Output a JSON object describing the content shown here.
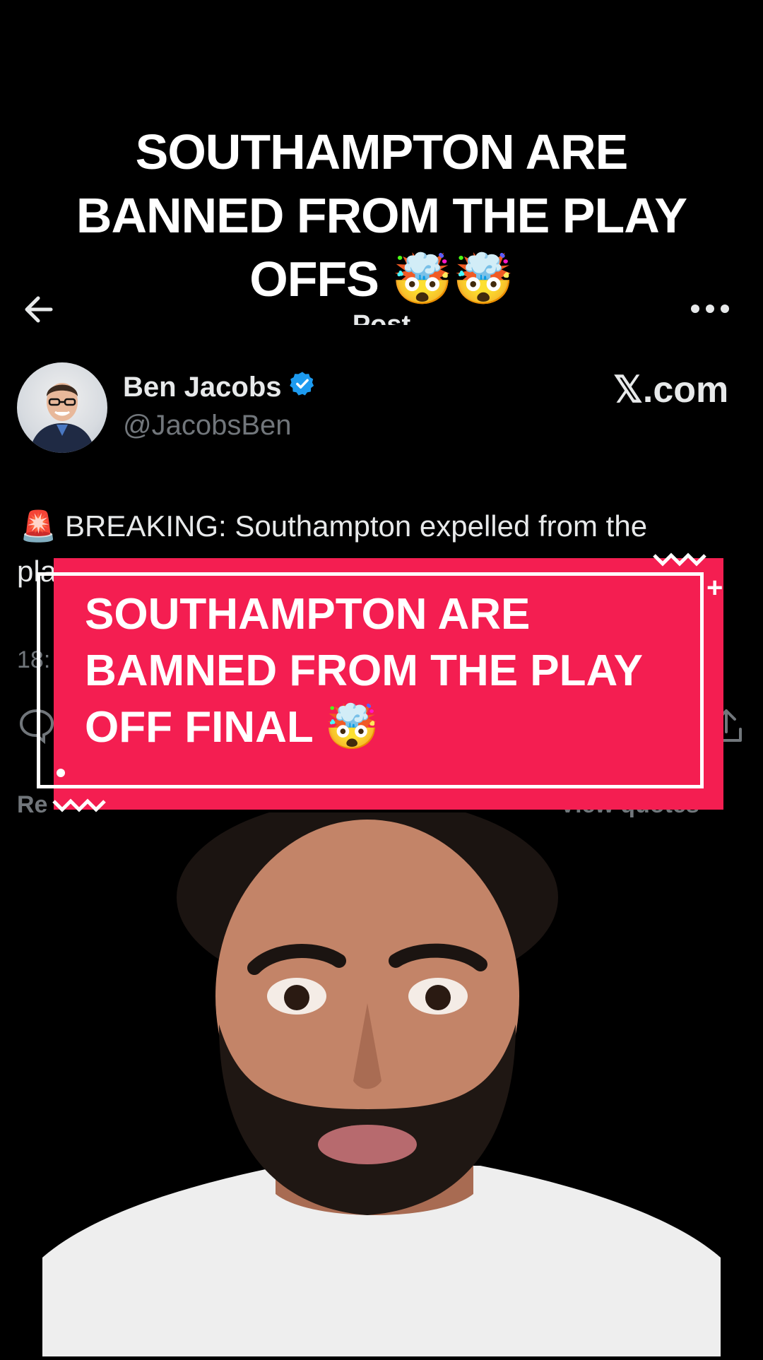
{
  "video_caption": "SOUTHAMPTON ARE BANNED FROM THE PLAY OFFS 🤯🤯",
  "post": {
    "header_title": "Post",
    "author": {
      "name": "Ben Jacobs",
      "handle": "@JacobsBen",
      "verified": true
    },
    "source": "𝕏.com",
    "text_line1": "🚨 BREAKING: Southampton expelled from the",
    "text_line2": "pla",
    "timestamp_partial": "18:",
    "repost_label": "Re",
    "quotes_label": "View quotes"
  },
  "banner": {
    "text": "SOUTHAMPTON ARE BAMNED FROM THE PLAY OFF FINAL 🤯",
    "color": "#f41e51"
  },
  "colors": {
    "background": "#000000",
    "text_primary": "#e7e9ea",
    "text_secondary": "#71767b",
    "verified_blue": "#1d9bf0"
  }
}
